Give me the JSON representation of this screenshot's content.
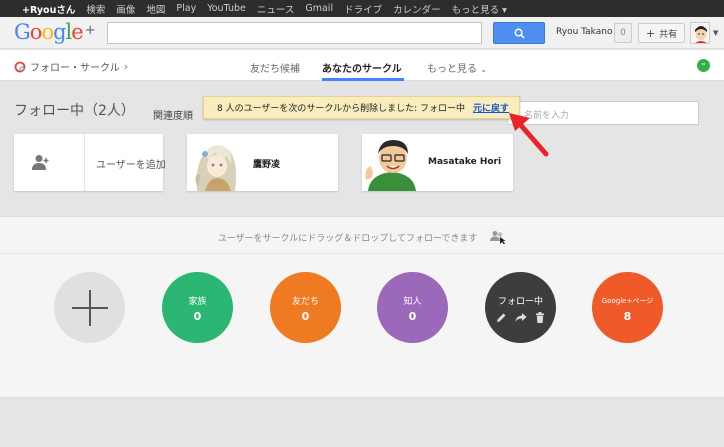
{
  "topbar": {
    "items": [
      "+Ryouさん",
      "検索",
      "画像",
      "地図",
      "Play",
      "YouTube",
      "ニュース",
      "Gmail",
      "ドライブ",
      "カレンダー",
      "もっと見る ▾"
    ]
  },
  "header": {
    "logo": "Google",
    "logo_plus": "+",
    "user_name": "Ryou Takano",
    "notification_count": "0",
    "share_label": "共有",
    "search_icon": "search-icon"
  },
  "subnav": {
    "breadcrumb": "フォロー・サークル",
    "tabs": [
      {
        "label": "友だち候補"
      },
      {
        "label": "あなたのサークル"
      },
      {
        "label": "もっと見る"
      }
    ]
  },
  "content": {
    "follow_title": "フォロー中（2人）",
    "sort_label": "関連度順",
    "name_placeholder": "名前を入力",
    "toast_message": "8 人のユーザーを次のサークルから削除しました: フォロー中",
    "toast_undo": "元に戻す",
    "add_user_label": "ユーザーを追加",
    "people": [
      {
        "name": "鷹野凌"
      },
      {
        "name": "Masatake Hori"
      }
    ]
  },
  "drop_area": {
    "hint": "ユーザーをサークルにドラッグ＆ドロップしてフォローできます"
  },
  "circles": [
    {
      "name": "家族",
      "count": "0",
      "color": "#2bb673"
    },
    {
      "name": "友だち",
      "count": "0",
      "color": "#ef7a22"
    },
    {
      "name": "知人",
      "count": "0",
      "color": "#9b68ba"
    },
    {
      "name": "フォロー中",
      "count": "",
      "color": "#3d3d3d"
    },
    {
      "name": "Google+ページ",
      "count": "8",
      "color": "#f05a28"
    }
  ],
  "colors": {
    "accent_blue": "#4285f4",
    "toast_bg": "#f9edbe",
    "arrow_red": "#e8232a"
  }
}
